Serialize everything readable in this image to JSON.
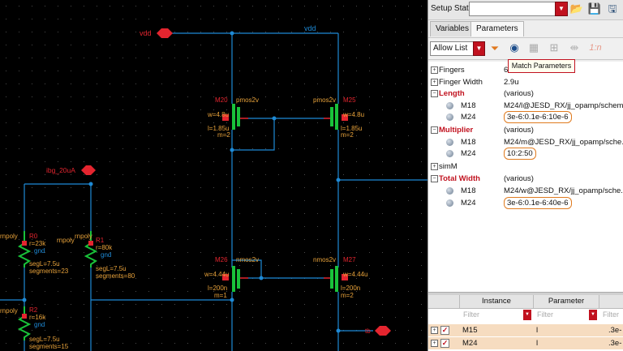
{
  "canvas": {
    "labels": {
      "vdd_pin": "vdd",
      "vdd_net": "vdd",
      "ibg_pin": "ibg_20uA",
      "m20_name": "M20",
      "m20_type": "pmos2v",
      "m20_w": "w=4.8u",
      "m20_l": "l=1.85u",
      "m20_m": "m=2",
      "m25_name": "M25",
      "m25_type": "pmos2v",
      "m25_w": "w=4.8u",
      "m25_l": "l=1.85u",
      "m25_m": "m=2",
      "m26_name": "M26",
      "m26_type": "nmos2v",
      "m26_w": "w=4.44u",
      "m26_l": "l=200n",
      "m26_m": "m=1",
      "m27_name": "M27",
      "m27_type": "nmos2v",
      "m27_w": "w=4.44u",
      "m27_l": "l=200n",
      "m27_m": "m=2",
      "r0_name": "R0",
      "r0_type": "rnpoly",
      "r0_r": "r=23k",
      "r0_gnd": "gnd",
      "r0_segl": "segL=7.5u",
      "r0_segs": "segments=23",
      "r1_name": "R1",
      "r1_type": "rnpoly",
      "r1_r": "r=80k",
      "r1_gnd": "gnd",
      "r1_segl": "segL=7.5u",
      "r1_segs": "segments=80",
      "r2_name": "R2",
      "r2_type": "rnpoly",
      "r2_r": "r=16k",
      "r2_gnd": "gnd",
      "r2_segl": "segL=7.5u",
      "r2_segs": "segments=15",
      "left_rnpoly": "rnpoly",
      "left_rnpoly2": "rnpoly",
      "out_label": "tb"
    }
  },
  "panel": {
    "setup_state_label": "Setup State:",
    "setup_state_value": "",
    "tabs": [
      "Variables",
      "Parameters"
    ],
    "active_tab": "Parameters",
    "filter_mode": "Allow List",
    "tooltip": "Match Parameters",
    "rows": [
      {
        "name": "Fingers",
        "value": "6",
        "kind": "collapsed"
      },
      {
        "name": "Finger Width",
        "value": "2.9u",
        "kind": "collapsed"
      },
      {
        "name": "Length",
        "value": "(various)",
        "kind": "section"
      },
      {
        "name": "M18",
        "value": "M24/l@JESD_RX/jj_opamp/schem...",
        "kind": "child"
      },
      {
        "name": "M24",
        "value": "3e-6:0.1e-6:10e-6",
        "kind": "child",
        "highlight": true
      },
      {
        "name": "Multiplier",
        "value": "(various)",
        "kind": "section"
      },
      {
        "name": "M18",
        "value": "M24/m@JESD_RX/jj_opamp/sche...",
        "kind": "child"
      },
      {
        "name": "M24",
        "value": "10:2:50",
        "kind": "child",
        "highlight": true
      },
      {
        "name": "simM",
        "value": "",
        "kind": "collapsed"
      },
      {
        "name": "Total Width",
        "value": "(various)",
        "kind": "section"
      },
      {
        "name": "M18",
        "value": "M24/w@JESD_RX/jj_opamp/sche...",
        "kind": "child"
      },
      {
        "name": "M24",
        "value": "3e-6:0.1e-6:40e-6",
        "kind": "child",
        "highlight": true
      }
    ],
    "instance_table": {
      "headers": [
        "Instance",
        "Parameter",
        ""
      ],
      "filter_placeholder": "Filter",
      "rows": [
        {
          "instance": "M15",
          "parameter": "l",
          "value": ".3e-"
        },
        {
          "instance": "M24",
          "parameter": "l",
          "value": ".3e-"
        }
      ]
    }
  },
  "colors": {
    "wire": "#1e8ad6",
    "label_orange": "#e8a23a",
    "pin_red": "#e4252f",
    "device_green": "#19c23a",
    "accent_red": "#c1121f",
    "highlight_orange": "#e07b1f"
  }
}
